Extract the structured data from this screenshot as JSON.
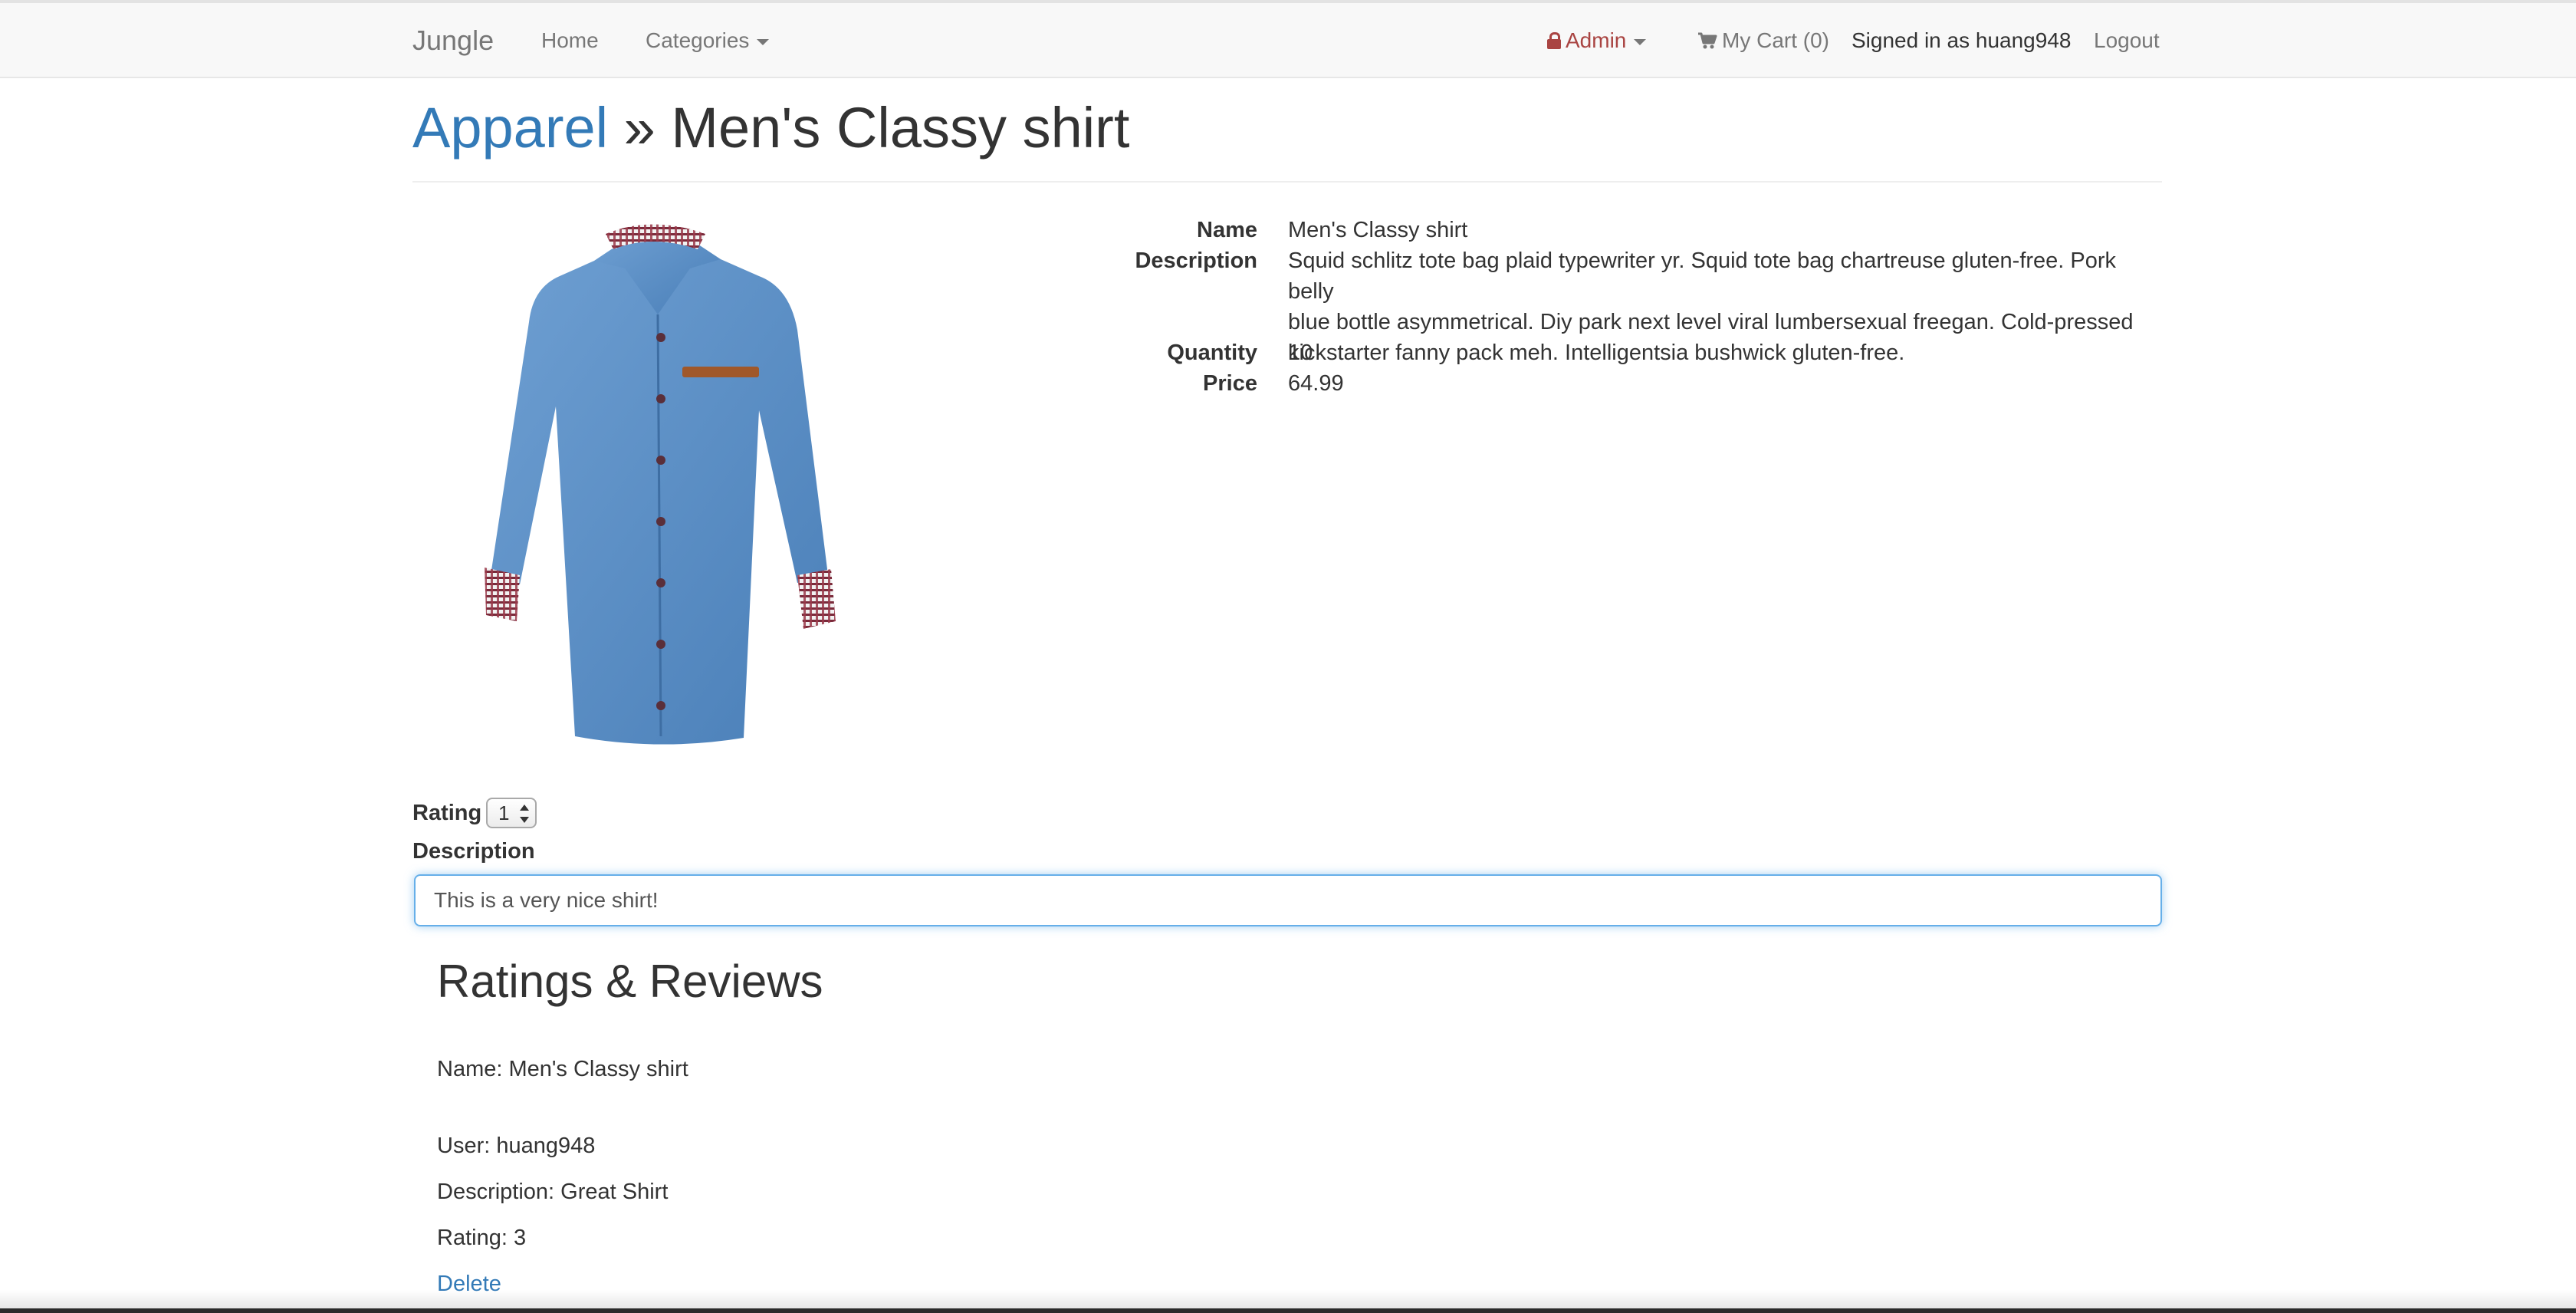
{
  "navbar": {
    "brand": "Jungle",
    "home": "Home",
    "categories": "Categories",
    "admin": "Admin",
    "cart": "My Cart (0)",
    "signed_in": "Signed in as huang948",
    "logout": "Logout"
  },
  "page": {
    "category": "Apparel",
    "separator": "»",
    "product_title": "Men's Classy shirt"
  },
  "product": {
    "labels": {
      "name": "Name",
      "description": "Description",
      "quantity": "Quantity",
      "price": "Price"
    },
    "name": "Men's Classy shirt",
    "description_lines": [
      "Squid schlitz tote bag plaid typewriter yr. Squid tote bag chartreuse gluten-free. Pork belly",
      "blue bottle asymmetrical. Diy park next level viral lumbersexual freegan. Cold-pressed",
      "kickstarter fanny pack meh. Intelligentsia bushwick gluten-free."
    ],
    "quantity": "10",
    "price": "64.99"
  },
  "review_form": {
    "rating_label": "Rating",
    "rating_value": "1",
    "description_label": "Description",
    "description_value": "This is a very nice shirt!"
  },
  "reviews": {
    "heading": "Ratings & Reviews",
    "name_line": "Name: Men's Classy shirt",
    "items": [
      {
        "user": "User: huang948",
        "description": "Description: Great Shirt",
        "rating": "Rating: 3",
        "delete": "Delete"
      }
    ]
  },
  "icons": {
    "admin": "lock-icon",
    "cart": "shopping-cart-icon",
    "categories": "chevron-down-icon"
  },
  "colors": {
    "link": "#337ab7",
    "admin": "#a94442",
    "navbar_bg": "#f8f8f8",
    "focus_border": "#66afe9"
  }
}
